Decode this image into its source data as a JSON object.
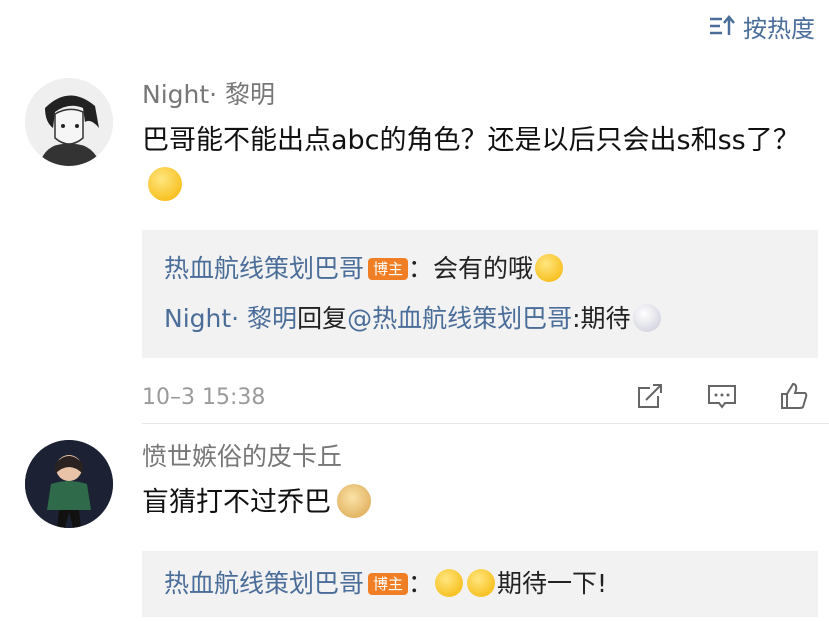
{
  "sort": {
    "label": "按热度"
  },
  "comments": [
    {
      "username": "Night· 黎明",
      "text": "巴哥能不能出点abc的角色？还是以后只会出s和ss了？",
      "time": "10–3 15:38",
      "replies": [
        {
          "author": "热血航线策划巴哥",
          "badge": "博主",
          "text": "：会有的哦"
        },
        {
          "author": "Night· 黎明",
          "middle": "回复",
          "mention": "@热血航线策划巴哥",
          "text": ":期待"
        }
      ]
    },
    {
      "username": "愤世嫉俗的皮卡丘",
      "text": "盲猜打不过乔巴",
      "replies": [
        {
          "author": "热血航线策划巴哥",
          "badge": "博主",
          "text": "：",
          "tail": "期待一下!"
        }
      ]
    }
  ],
  "colors": {
    "link": "#4a6d9a",
    "badge": "#f07e25",
    "reply_bg": "#f2f2f2"
  }
}
